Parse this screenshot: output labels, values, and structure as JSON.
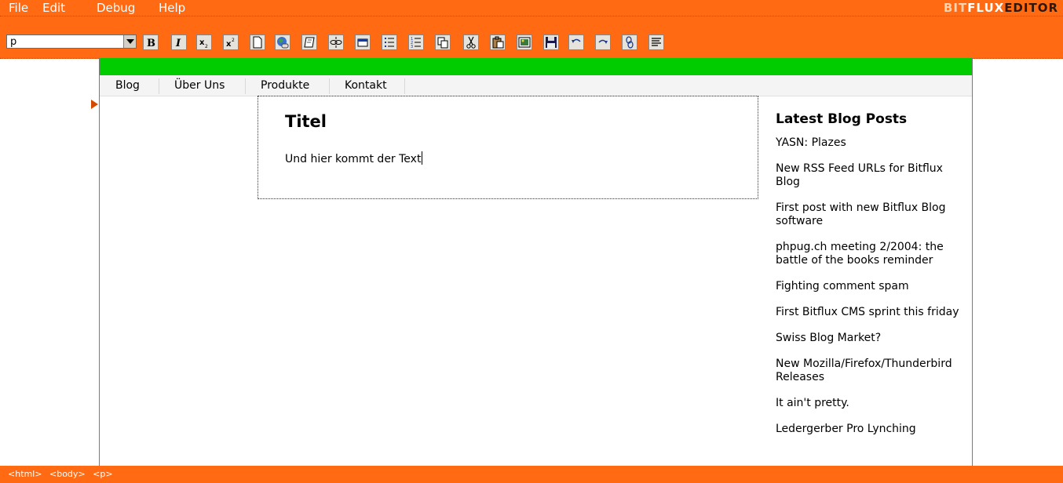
{
  "menubar": {
    "items": [
      {
        "label": "File"
      },
      {
        "label": "Edit"
      },
      {
        "label": "Debug"
      },
      {
        "label": "Help"
      }
    ],
    "brand": {
      "part1": "BIT",
      "part2": "FLUX",
      "part3": "EDITOR"
    }
  },
  "toolbar": {
    "block_format_value": "p",
    "buttons": [
      {
        "name": "bold-button",
        "icon": "bold-icon"
      },
      {
        "name": "italic-button",
        "icon": "italic-icon"
      },
      {
        "name": "subscript-button",
        "icon": "subscript-icon"
      },
      {
        "name": "superscript-button",
        "icon": "superscript-icon"
      },
      {
        "name": "new-document-button",
        "icon": "document-icon"
      },
      {
        "name": "insert-link-button",
        "icon": "globe-link-icon"
      },
      {
        "name": "insert-note-button",
        "icon": "note-icon"
      },
      {
        "name": "unlink-button",
        "icon": "broken-link-icon"
      },
      {
        "name": "insert-table-button",
        "icon": "table-icon"
      },
      {
        "name": "unordered-list-button",
        "icon": "bulleted-list-icon"
      },
      {
        "name": "ordered-list-button",
        "icon": "numbered-list-icon"
      },
      {
        "name": "copy-button",
        "icon": "copy-icon"
      },
      {
        "name": "cut-button",
        "icon": "scissors-icon"
      },
      {
        "name": "paste-button",
        "icon": "paste-icon"
      },
      {
        "name": "insert-image-button",
        "icon": "image-icon"
      },
      {
        "name": "save-button",
        "icon": "floppy-disk-icon"
      },
      {
        "name": "undo-button",
        "icon": "undo-icon"
      },
      {
        "name": "redo-button",
        "icon": "redo-icon"
      },
      {
        "name": "anchor-button",
        "icon": "chain-link-icon"
      },
      {
        "name": "align-button",
        "icon": "align-lines-icon"
      }
    ]
  },
  "nav": {
    "items": [
      {
        "label": "Blog"
      },
      {
        "label": "Über Uns"
      },
      {
        "label": "Produkte"
      },
      {
        "label": "Kontakt"
      }
    ]
  },
  "content": {
    "title": "Titel",
    "text": "Und hier kommt der Text"
  },
  "sidebar": {
    "title": "Latest Blog Posts",
    "posts": [
      {
        "label": "YASN: Plazes"
      },
      {
        "label": "New RSS Feed URLs for Bitflux Blog"
      },
      {
        "label": "First post with new Bitflux Blog software"
      },
      {
        "label": "phpug.ch meeting 2/2004: the battle of the books reminder"
      },
      {
        "label": "Fighting comment spam"
      },
      {
        "label": "First Bitflux CMS sprint this friday"
      },
      {
        "label": "Swiss Blog Market?"
      },
      {
        "label": "New Mozilla/Firefox/Thunderbird Releases"
      },
      {
        "label": "It ain't pretty."
      },
      {
        "label": "Ledergerber Pro Lynching"
      }
    ]
  },
  "statusbar": {
    "path": [
      "<html>",
      "<body>",
      "<p>"
    ]
  },
  "colors": {
    "accent": "#ff6a12",
    "header_green": "#00cc00"
  }
}
